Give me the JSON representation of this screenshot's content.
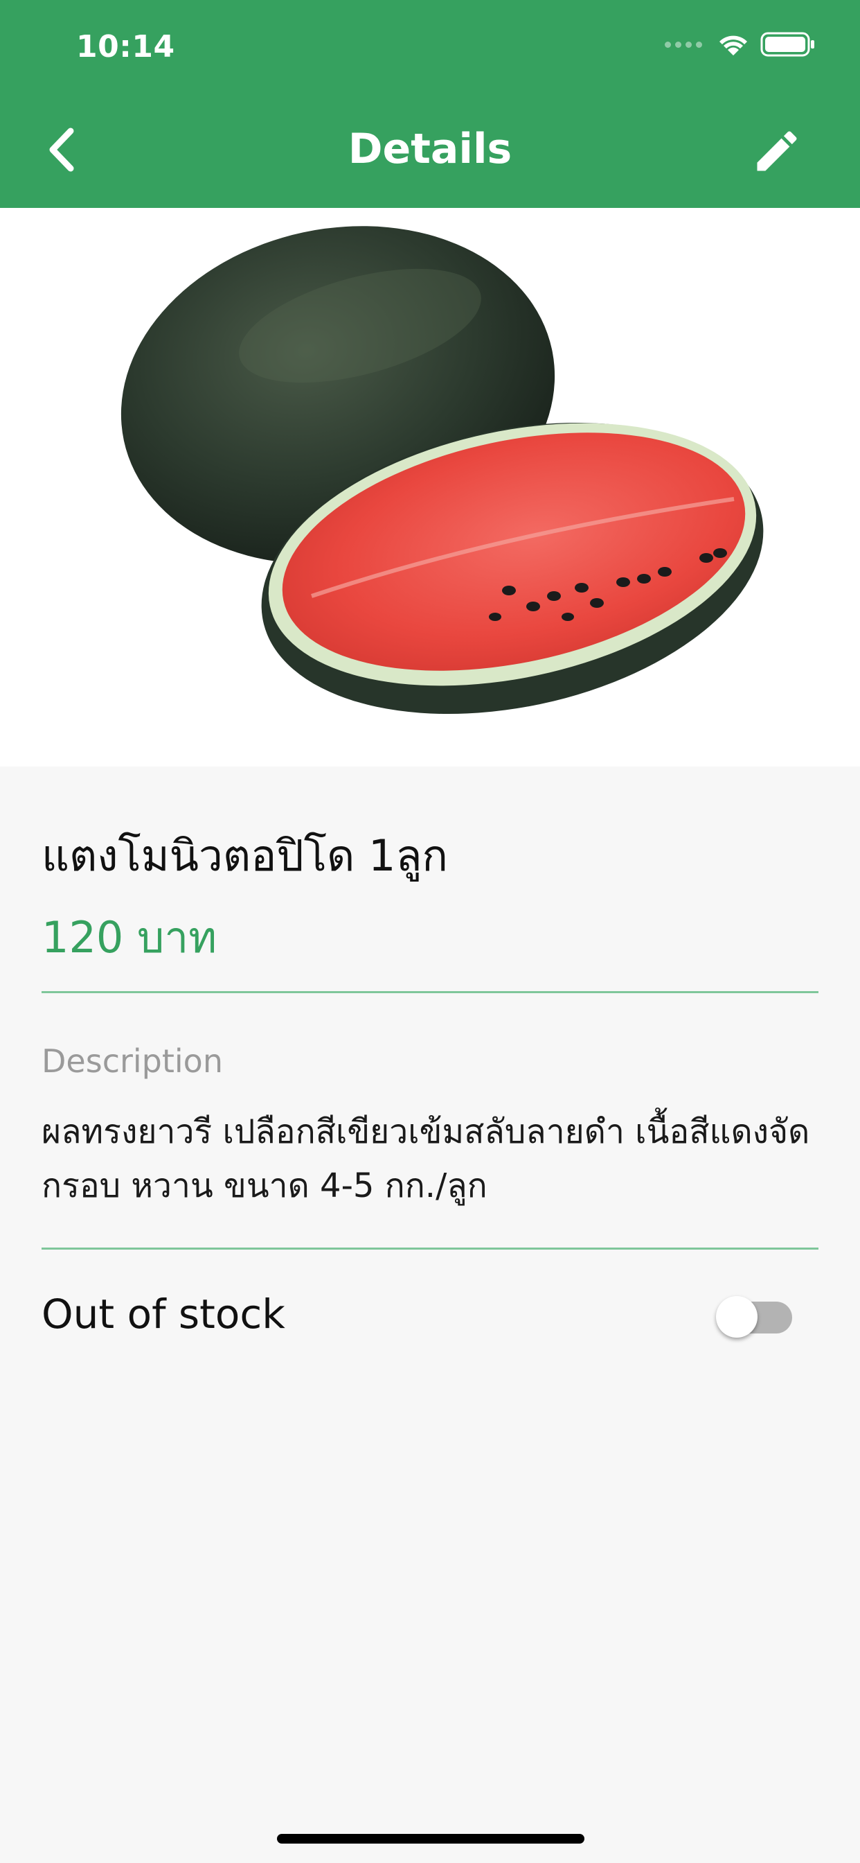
{
  "status_bar": {
    "time": "10:14"
  },
  "nav": {
    "title": "Details",
    "back_icon": "chevron-left-icon",
    "edit_icon": "pencil-icon"
  },
  "product": {
    "name": "แตงโมนิวตอปิโด 1ลูก",
    "price": "120 บาท",
    "description_label": "Description",
    "description_line1": "ผลทรงยาวรี เปลือกสีเขียวเข้มสลับลายดำ เนื้อสีแดงจัด",
    "description_line2": "กรอบ หวาน ขนาด 4-5 กก./ลูก",
    "out_of_stock_label": "Out of stock",
    "out_of_stock": false
  },
  "colors": {
    "primary": "#36a15f",
    "divider": "#7fc69a",
    "background": "#f7f7f7"
  }
}
